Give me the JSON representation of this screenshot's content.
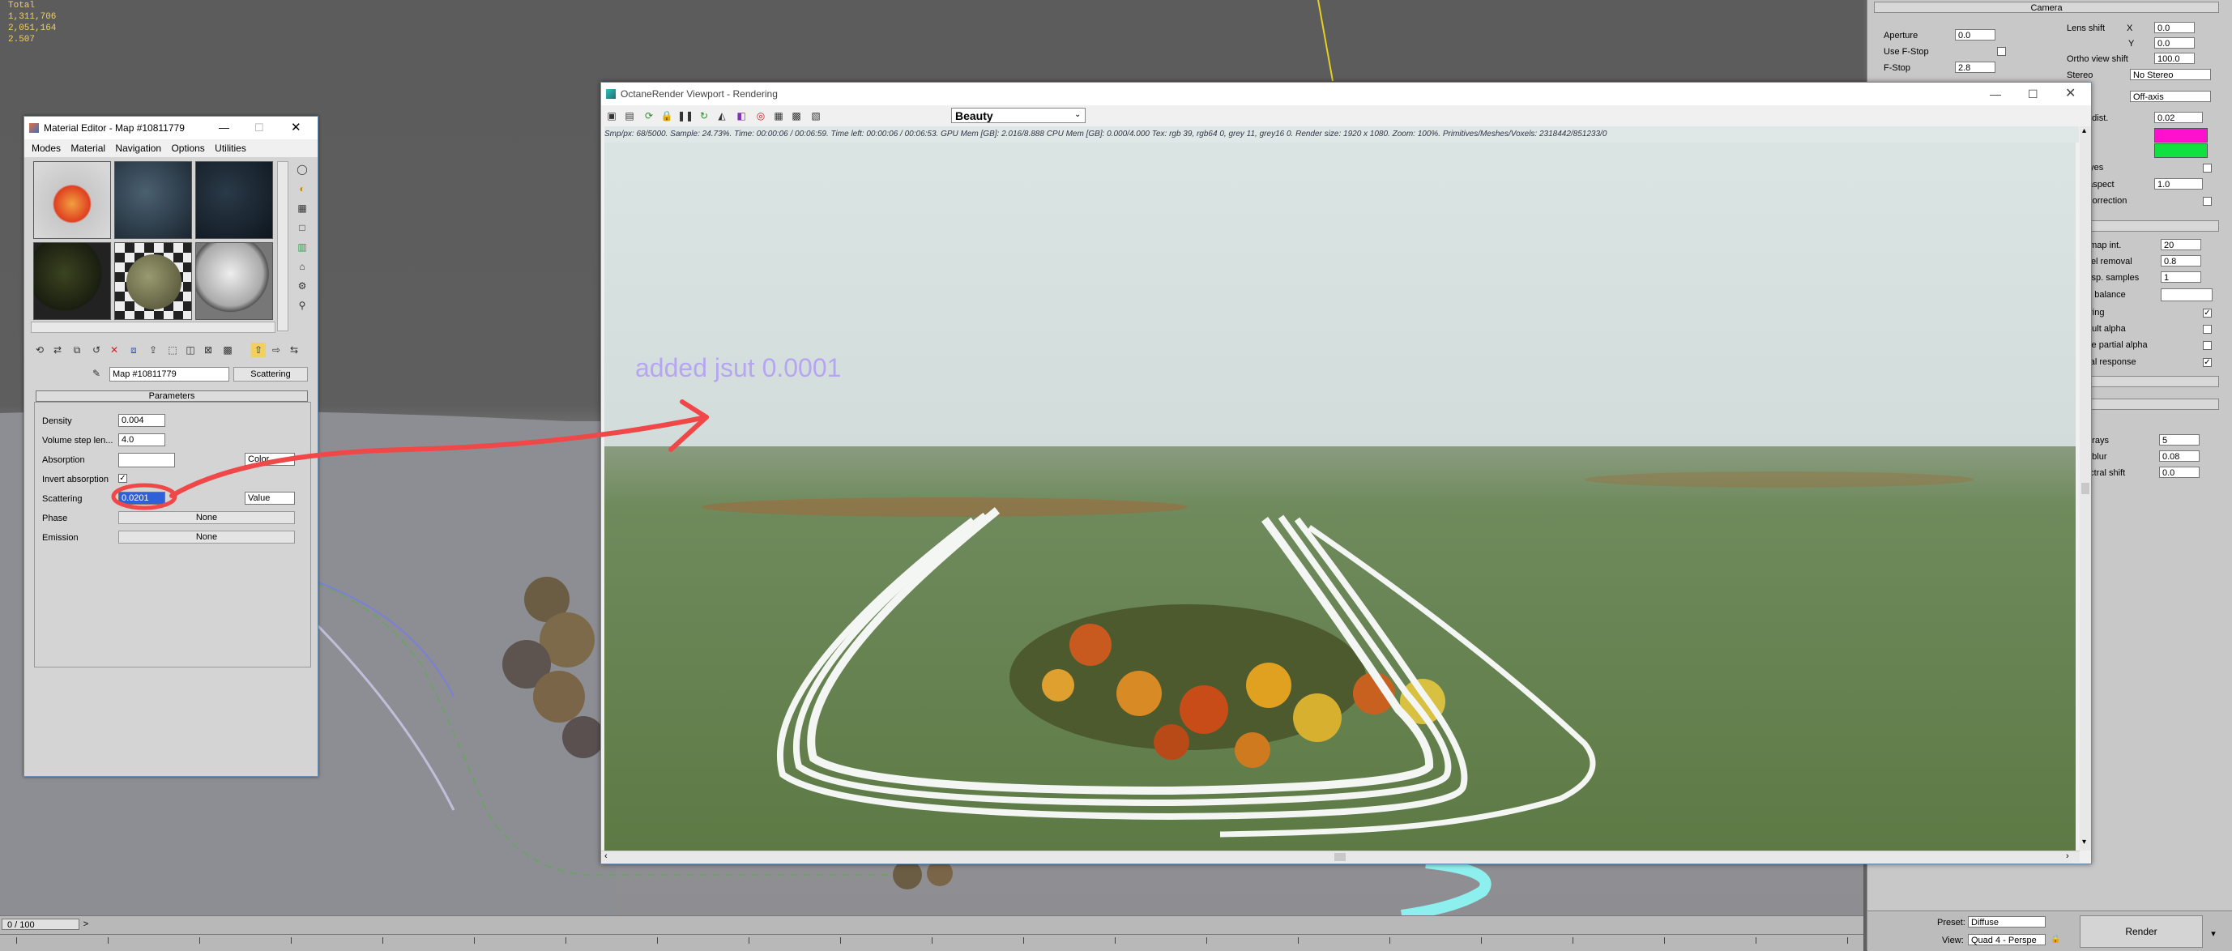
{
  "viewport": {
    "stats": [
      "Total",
      "1,311,706",
      "2,051,164",
      "",
      "2.507"
    ]
  },
  "material_editor": {
    "title": "Material Editor - Map #10811779",
    "menu": [
      "Modes",
      "Material",
      "Navigation",
      "Options",
      "Utilities"
    ],
    "map_name": "Map #10811779",
    "map_type": "Scattering",
    "parameters_header": "Parameters",
    "params": {
      "density_label": "Density",
      "density_value": "0.004",
      "volume_step_label": "Volume step len...",
      "volume_step_value": "4.0",
      "absorption_label": "Absorption",
      "absorption_mode": "Color",
      "invert_absorption_label": "Invert absorption",
      "scattering_label": "Scattering",
      "scattering_value": "0.0201",
      "scattering_mode": "Value",
      "phase_label": "Phase",
      "phase_value": "None",
      "emission_label": "Emission",
      "emission_value": "None"
    }
  },
  "octane": {
    "title": "OctaneRender Viewport - Rendering",
    "pass_select": "Beauty",
    "status": "Smp/px: 68/5000.   Sample: 24.73%.   Time: 00:00:06 / 00:06:59.   Time left: 00:00:06 / 00:06:53.   GPU Mem [GB]: 2.016/8.888   CPU Mem [GB]: 0.000/4.000   Tex: rgb 39, rgb64 0, grey 11, grey16 0.   Render size: 1920 x 1080.   Zoom: 100%.   Primitives/Meshes/Voxels: 2318442/851233/0",
    "annotation": "added jsut 0.0001"
  },
  "camera_panel": {
    "header": "Camera",
    "aperture_label": "Aperture",
    "aperture_value": "0.0",
    "use_fstop_label": "Use F-Stop",
    "fstop_label": "F-Stop",
    "fstop_value": "2.8",
    "lens_shift_label": "Lens shift",
    "x_label": "X",
    "x_value": "0.0",
    "y_label": "Y",
    "y_value": "0.0",
    "ortho_label": "Ortho view shift",
    "ortho_value": "100.0",
    "stereo_label": "Stereo",
    "stereo_value": "No Stereo",
    "stereo_mode": "Off-axis",
    "eye_dist_label": "o dist.",
    "eye_dist_value": "0.02",
    "left_color": "#ff10d0",
    "right_color": "#10e040",
    "swap_eyes_label": "eyes",
    "pixel_aspect_label": ". aspect",
    "pixel_aspect_value": "1.0",
    "correction_label": ". correction",
    "filmap_label": "emap int.",
    "filmap_value": "20",
    "pixel_removal_label": "ixel removal",
    "pixel_removal_value": "0.8",
    "disp_samples_label": "disp. samples",
    "disp_samples_value": "1",
    "white_balance_label": "te balance",
    "rendering_label": "ering",
    "premult_label": "mult alpha",
    "partial_alpha_label": "ble partial alpha",
    "neutral_label": "tral response",
    "rays_label": "e rays",
    "rays_value": "5",
    "blur_label": "e blur",
    "blur_value": "0.08",
    "spectral_label": "ectral shift",
    "spectral_value": "0.0",
    "preset_label": "Preset:",
    "preset_value": "Diffuse",
    "view_label": "View:",
    "view_value": "Quad 4 - Perspe",
    "render_button": "Render"
  },
  "timeline": {
    "frame": "0 / 100",
    "next": ">"
  }
}
